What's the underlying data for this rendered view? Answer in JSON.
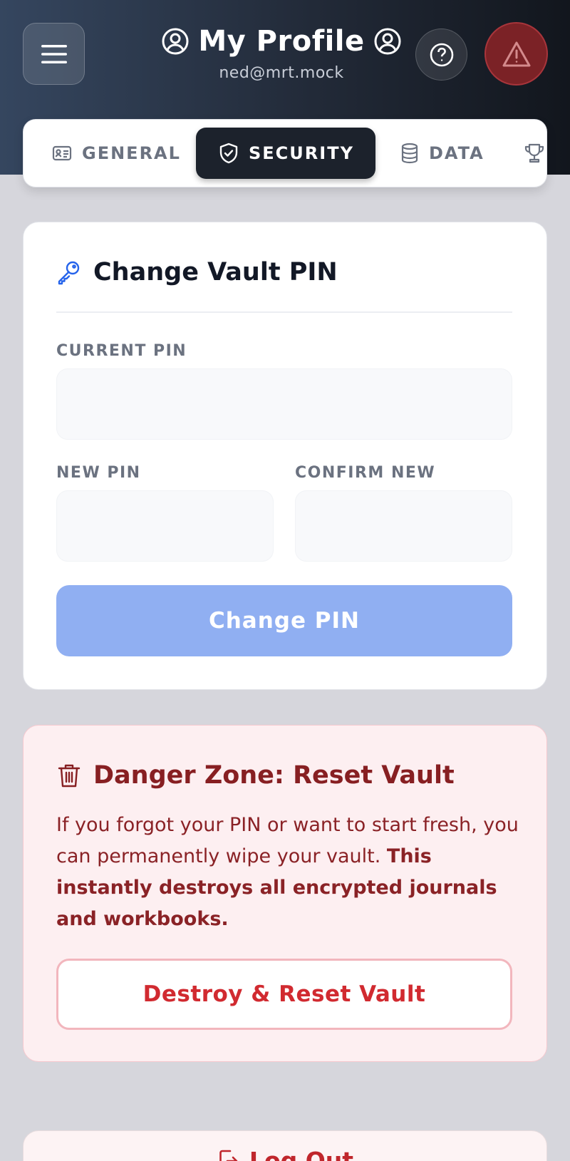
{
  "header": {
    "title": "My Profile",
    "subtitle": "ned@mrt.mock",
    "icons": {
      "menu": "menu-icon",
      "user": "user-circle-icon",
      "help": "help-circle-icon",
      "alert": "alert-triangle-icon"
    }
  },
  "tabs": [
    {
      "label": "GENERAL",
      "icon": "id-card-icon",
      "active": false
    },
    {
      "label": "SECURITY",
      "icon": "shield-check-icon",
      "active": true
    },
    {
      "label": "DATA",
      "icon": "database-icon",
      "active": false
    },
    {
      "label": "",
      "icon": "trophy-icon",
      "active": false
    }
  ],
  "pin_card": {
    "title": "Change Vault PIN",
    "icon": "key-icon",
    "current_label": "CURRENT PIN",
    "current_value": "",
    "new_label": "NEW PIN",
    "new_value": "",
    "confirm_label": "CONFIRM NEW",
    "confirm_value": "",
    "submit_label": "Change PIN"
  },
  "danger_card": {
    "title": "Danger Zone: Reset Vault",
    "icon": "trash-icon",
    "text": "If you forgot your PIN or want to start fresh, you can permanently wipe your vault.",
    "text_bold": "This instantly destroys all encrypted journals and workbooks.",
    "button_label": "Destroy & Reset Vault"
  },
  "logout": {
    "label": "Log Out",
    "icon": "logout-icon"
  },
  "colors": {
    "header_start": "#35465f",
    "header_end": "#12161d",
    "primary_button": "#90aff2",
    "danger_text": "#871f22",
    "danger_button_text": "#d12a30",
    "alert_button": "#7b2226"
  }
}
